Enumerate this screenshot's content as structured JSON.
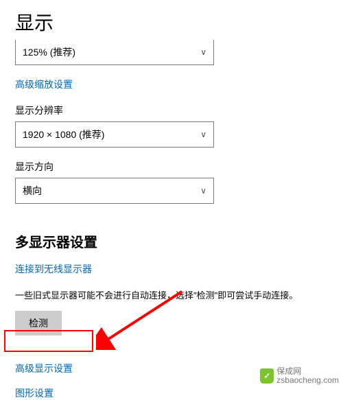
{
  "page": {
    "title": "显示"
  },
  "scale": {
    "selected": "125% (推荐)"
  },
  "links": {
    "advanced_scale": "高级缩放设置",
    "wireless_display": "连接到无线显示器",
    "advanced_display": "高级显示设置",
    "graphics_settings": "图形设置"
  },
  "resolution": {
    "label": "显示分辨率",
    "selected": "1920 × 1080 (推荐)"
  },
  "orientation": {
    "label": "显示方向",
    "selected": "横向"
  },
  "multi_display": {
    "heading": "多显示器设置",
    "desc": "一些旧式显示器可能不会进行自动连接，选择\"检测\"即可尝试手动连接。",
    "detect_btn": "检测"
  },
  "watermark": {
    "text": "保成网",
    "url": "zsbaocheng.com"
  }
}
